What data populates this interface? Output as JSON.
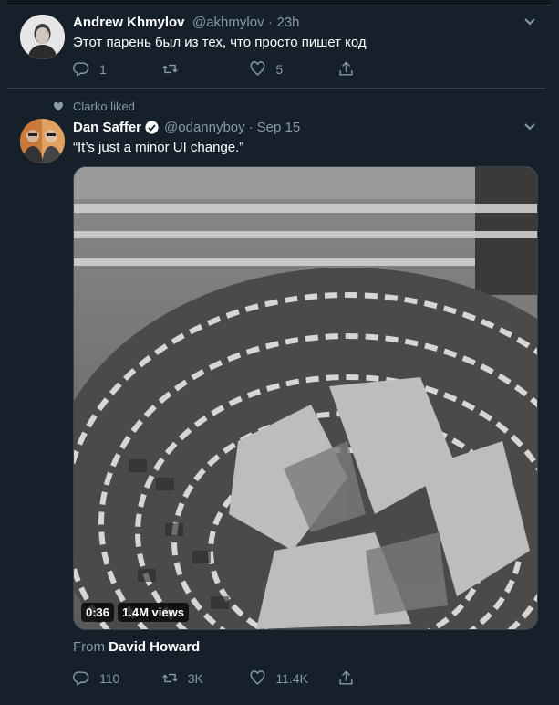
{
  "tweet1": {
    "name": "Andrew Khmylov",
    "handle": "@akhmylov",
    "separator": "·",
    "time": "23h",
    "text": "Этот парень был из тех, что просто пишет код",
    "replies": "1",
    "retweets": "",
    "likes": "5"
  },
  "tweet2": {
    "social_context": "Clarko liked",
    "name": "Dan Saffer",
    "handle": "@odannyboy",
    "separator": "·",
    "time": "Sep 15",
    "text": "“It’s just a minor UI change.”",
    "video": {
      "duration": "0:36",
      "views": "1.4M views"
    },
    "from_label": "From",
    "from_name": "David Howard",
    "replies": "110",
    "retweets": "3K",
    "likes": "11.4K"
  },
  "colors": {
    "background": "#15202b",
    "muted": "#8899a6",
    "border": "#38444d"
  },
  "icons": [
    "chevron-down-icon",
    "reply-icon",
    "retweet-icon",
    "like-icon",
    "share-icon",
    "verified-icon",
    "heart-icon"
  ]
}
